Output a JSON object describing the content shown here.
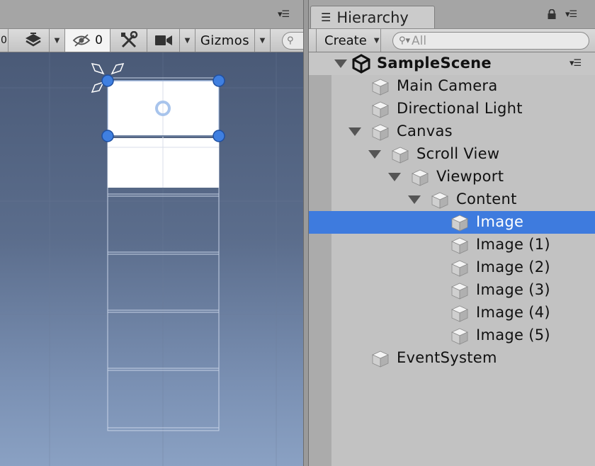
{
  "scene_toolbar": {
    "hidden_count": "0",
    "gizmos_label": "Gizmos"
  },
  "hierarchy": {
    "tab_title": "Hierarchy",
    "create_label": "Create",
    "search_placeholder": "All",
    "scene_name": "SampleScene",
    "items": [
      {
        "label": "Main Camera",
        "depth": 0,
        "expanded": null,
        "selected": false
      },
      {
        "label": "Directional Light",
        "depth": 0,
        "expanded": null,
        "selected": false
      },
      {
        "label": "Canvas",
        "depth": 0,
        "expanded": true,
        "selected": false
      },
      {
        "label": "Scroll View",
        "depth": 1,
        "expanded": true,
        "selected": false
      },
      {
        "label": "Viewport",
        "depth": 2,
        "expanded": true,
        "selected": false
      },
      {
        "label": "Content",
        "depth": 3,
        "expanded": true,
        "selected": false
      },
      {
        "label": "Image",
        "depth": 4,
        "expanded": null,
        "selected": true
      },
      {
        "label": "Image (1)",
        "depth": 4,
        "expanded": null,
        "selected": false
      },
      {
        "label": "Image (2)",
        "depth": 4,
        "expanded": null,
        "selected": false
      },
      {
        "label": "Image (3)",
        "depth": 4,
        "expanded": null,
        "selected": false
      },
      {
        "label": "Image (4)",
        "depth": 4,
        "expanded": null,
        "selected": false
      },
      {
        "label": "Image (5)",
        "depth": 4,
        "expanded": null,
        "selected": false
      },
      {
        "label": "EventSystem",
        "depth": 0,
        "expanded": null,
        "selected": false
      }
    ]
  },
  "colors": {
    "selection": "#3e7bde",
    "handle": "#3f7fe0"
  }
}
